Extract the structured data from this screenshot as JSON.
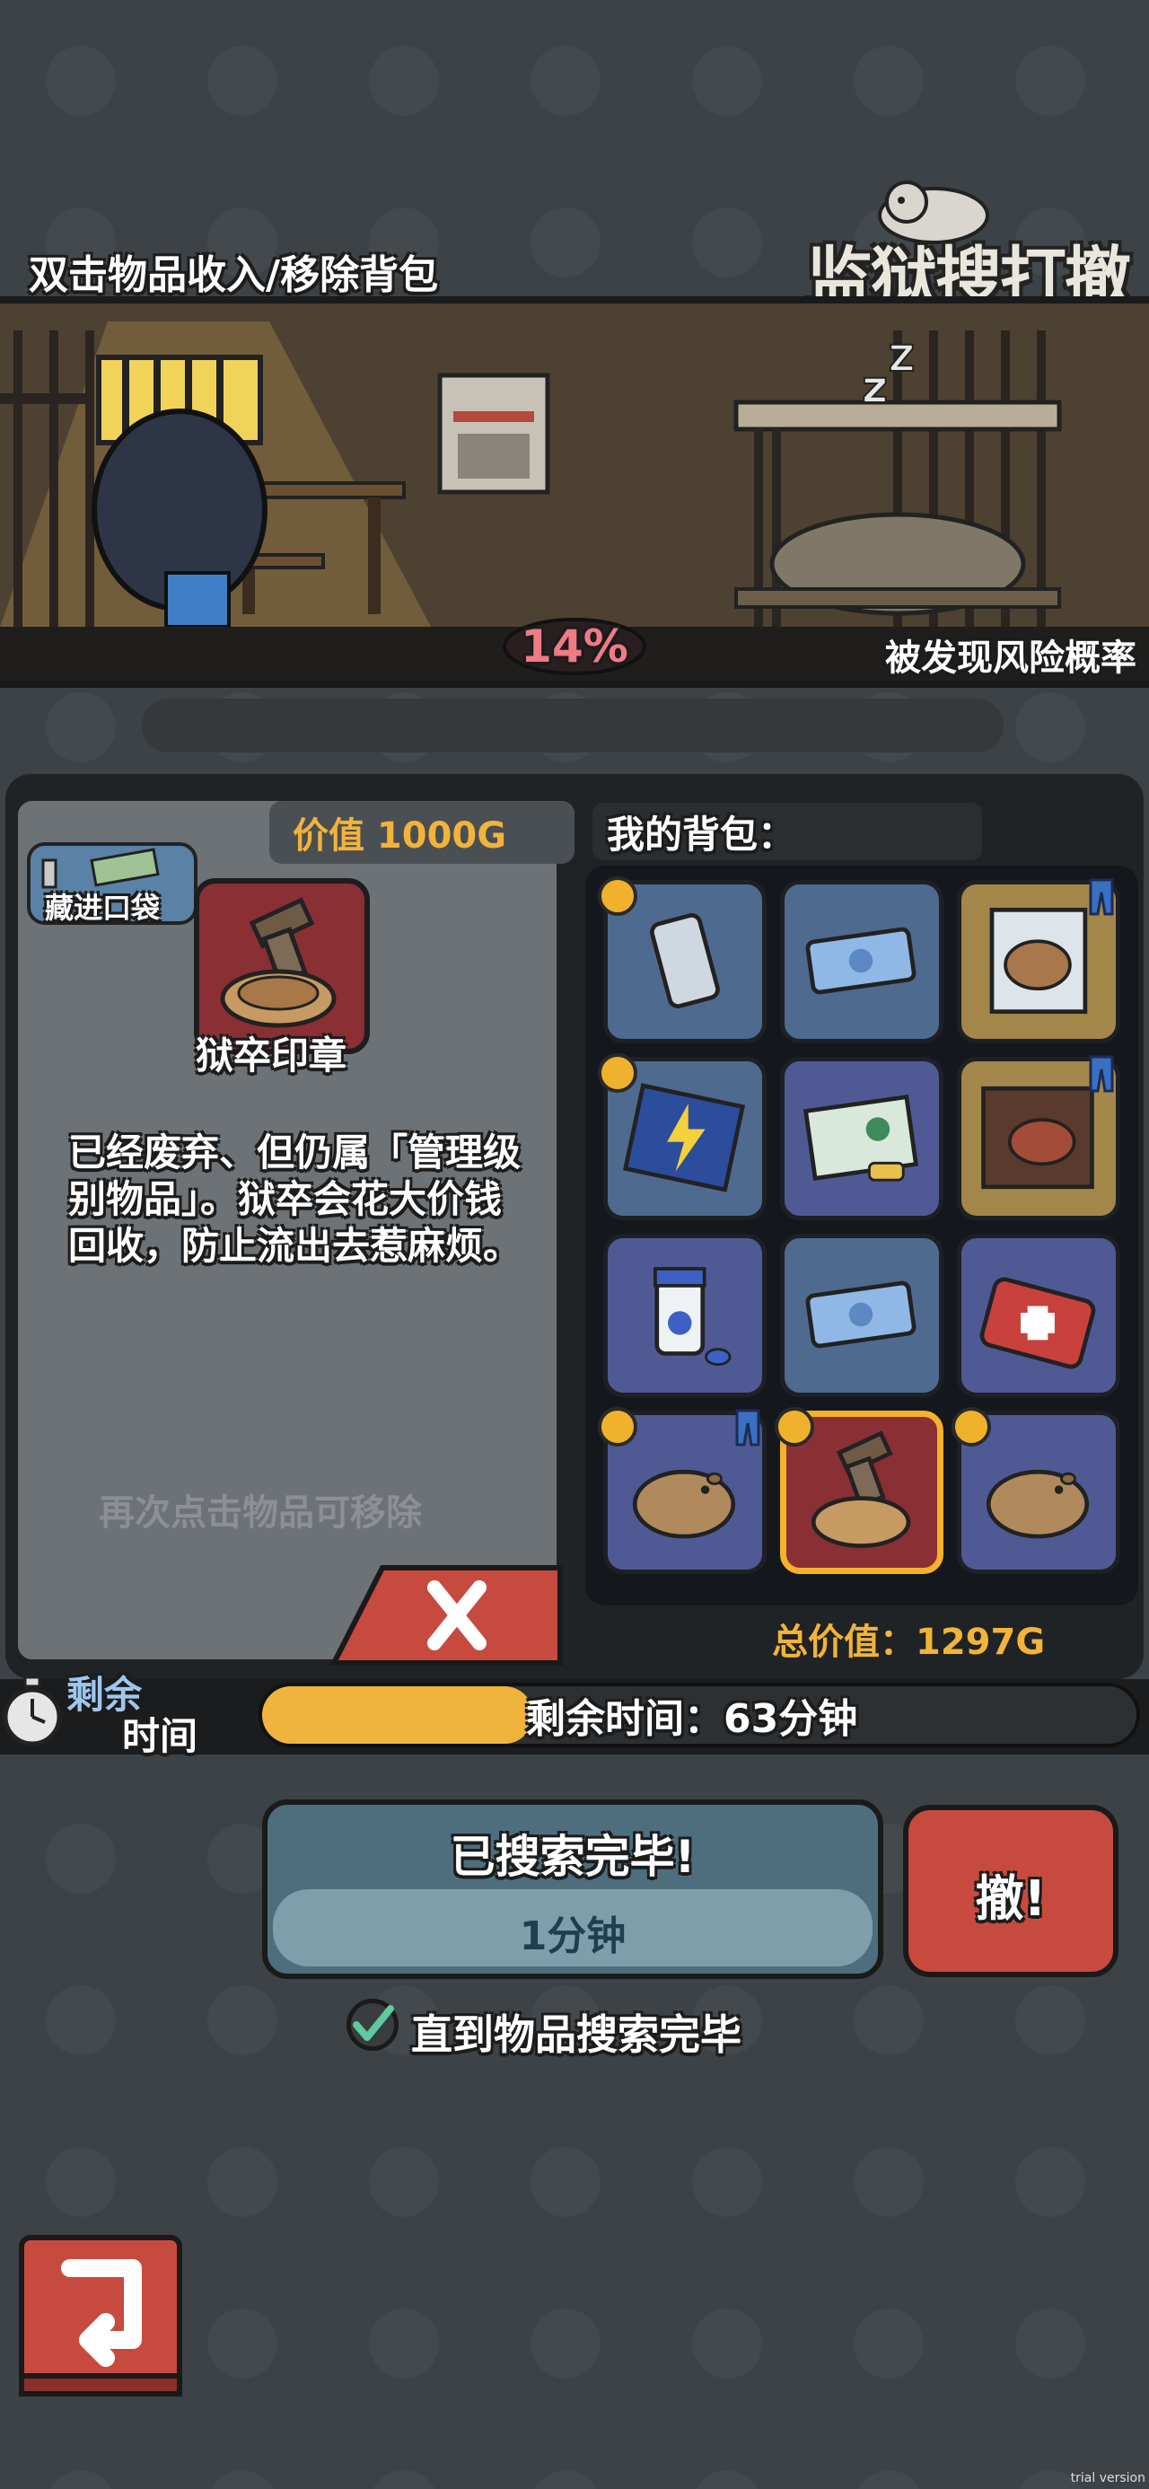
{
  "header": {
    "hint": "双击物品收入/移除背包",
    "logo": "监狱搜打撤"
  },
  "scene": {
    "risk_percent": "14%",
    "risk_label": "被发现风险概率",
    "risk_level": 0.14
  },
  "item_panel": {
    "value": "价值 1000G",
    "pocket_button": "藏进口袋",
    "item_name": "狱卒印章",
    "description": "已经废弃、但仍属「管理级别物品」。狱卒会花大价钱回收，防止流出去惹麻烦。",
    "remove_hint": "再次点击物品可移除"
  },
  "backpack": {
    "title": "我的背包：",
    "total": "总价值：1297G",
    "slots": [
      {
        "icon": "phone-icon",
        "color": "#4f6a8f",
        "coin": true,
        "pants": false
      },
      {
        "icon": "cash-bundle-icon",
        "color": "#4f6a8f",
        "coin": false,
        "pants": false
      },
      {
        "icon": "capybara-card-icon",
        "color": "#a3874a",
        "coin": false,
        "pants": true
      },
      {
        "icon": "lightning-card-icon",
        "color": "#4f6a8f",
        "coin": true,
        "pants": false
      },
      {
        "icon": "book-pills-icon",
        "color": "#4f5a94",
        "coin": false,
        "pants": false
      },
      {
        "icon": "steak-package-icon",
        "color": "#a3874a",
        "coin": false,
        "pants": true
      },
      {
        "icon": "medicine-bottle-icon",
        "color": "#4f5a94",
        "coin": false,
        "pants": false
      },
      {
        "icon": "cash-bundle-icon",
        "color": "#4f6a8f",
        "coin": false,
        "pants": false
      },
      {
        "icon": "first-aid-kit-icon",
        "color": "#4f5a94",
        "coin": false,
        "pants": false
      },
      {
        "icon": "capybara-icon",
        "color": "#4f5a94",
        "coin": true,
        "pants": true
      },
      {
        "icon": "guard-seal-icon",
        "color": "#8a2f34",
        "coin": true,
        "pants": false,
        "selected": true
      },
      {
        "icon": "capybara-icon",
        "color": "#4f5a94",
        "coin": true,
        "pants": false
      }
    ]
  },
  "timer": {
    "label_top": "剩余",
    "label_bottom": "时间",
    "text": "剩余时间：63分钟",
    "fill_fraction": 0.31
  },
  "search": {
    "title": "已搜索完毕!",
    "subtitle": "1分钟",
    "flee": "撤!",
    "checkbox_label": "直到物品搜索完毕",
    "checkbox_checked": true
  },
  "watermark": "trial version",
  "colors": {
    "gold": "#f2b33a",
    "accent_red": "#c74a3f",
    "panel_gray": "#6d7277",
    "dark": "#202326"
  }
}
